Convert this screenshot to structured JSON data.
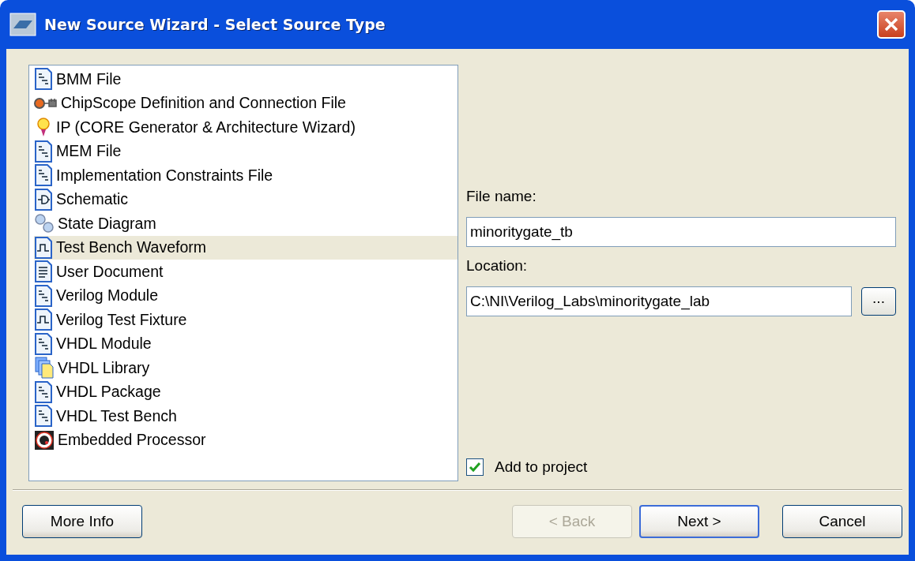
{
  "window": {
    "title": "New Source Wizard - Select Source Type"
  },
  "source_types": [
    {
      "label": "BMM File",
      "kind": "document",
      "selected": false
    },
    {
      "label": "ChipScope Definition and Connection File",
      "kind": "probe",
      "selected": false
    },
    {
      "label": "IP (CORE Generator & Architecture Wizard)",
      "kind": "bulb",
      "selected": false
    },
    {
      "label": "MEM File",
      "kind": "document",
      "selected": false
    },
    {
      "label": "Implementation Constraints File",
      "kind": "document",
      "selected": false
    },
    {
      "label": "Schematic",
      "kind": "schematic",
      "selected": false
    },
    {
      "label": "State Diagram",
      "kind": "circles",
      "selected": false
    },
    {
      "label": "Test Bench Waveform",
      "kind": "waveform",
      "selected": true
    },
    {
      "label": "User Document",
      "kind": "text",
      "selected": false
    },
    {
      "label": "Verilog Module",
      "kind": "document",
      "selected": false
    },
    {
      "label": "Verilog Test Fixture",
      "kind": "waveform",
      "selected": false
    },
    {
      "label": "VHDL Module",
      "kind": "document",
      "selected": false
    },
    {
      "label": "VHDL Library",
      "kind": "library",
      "selected": false
    },
    {
      "label": "VHDL Package",
      "kind": "document",
      "selected": false
    },
    {
      "label": "VHDL Test Bench",
      "kind": "document",
      "selected": false
    },
    {
      "label": "Embedded Processor",
      "kind": "processor",
      "selected": false
    }
  ],
  "file_name": {
    "label": "File name:",
    "value": "minoritygate_tb"
  },
  "location": {
    "label": "Location:",
    "value": "C:\\NI\\Verilog_Labs\\minoritygate_lab",
    "browse": "..."
  },
  "add_to_project": {
    "label": "Add to project",
    "checked": true
  },
  "buttons_left": [
    {
      "label": "More Info",
      "disabled": false,
      "default": false
    }
  ],
  "buttons_right": [
    {
      "label": "< Back",
      "disabled": true,
      "default": false
    },
    {
      "label": "Next >",
      "disabled": false,
      "default": true
    },
    {
      "label": "Cancel",
      "disabled": false,
      "default": false
    }
  ]
}
